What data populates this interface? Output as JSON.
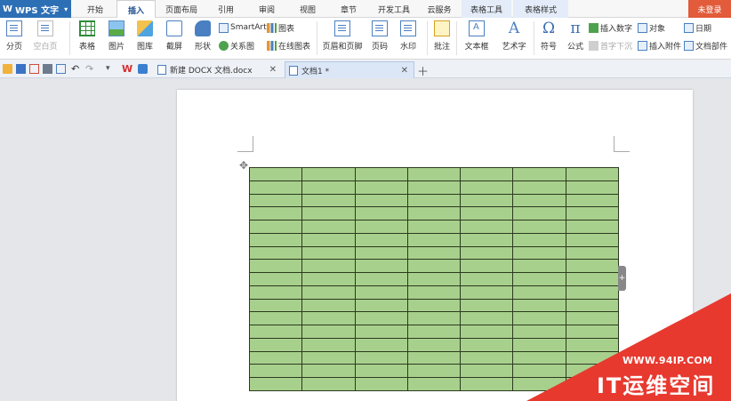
{
  "app": {
    "name": "WPS 文字"
  },
  "menu_tabs": [
    "开始",
    "插入",
    "页面布局",
    "引用",
    "审阅",
    "视图",
    "章节",
    "开发工具",
    "云服务",
    "表格工具",
    "表格样式"
  ],
  "active_tab": "插入",
  "login_label": "未登录",
  "ribbon": {
    "page_break": "分页",
    "blank_page": "空白页",
    "table": "表格",
    "picture": "图片",
    "gallery": "图库",
    "screenshot": "截屏",
    "shapes": "形状",
    "smartart": "SmartArt",
    "chart": "图表",
    "relation_chart": "关系图",
    "online_chart": "在线图表",
    "header_footer": "页眉和页脚",
    "page_number": "页码",
    "watermark": "水印",
    "comment": "批注",
    "textbox": "文本框",
    "wordart": "艺术字",
    "symbol": "符号",
    "formula": "公式",
    "drop_cap": "首字下沉",
    "insert_number": "插入数字",
    "object": "对象",
    "date": "日期",
    "insert_attachment": "插入附件",
    "doc_parts": "文档部件"
  },
  "doc_tabs": [
    {
      "title": "新建 DOCX 文档.docx",
      "active": false
    },
    {
      "title": "文档1 *",
      "active": true
    }
  ],
  "table": {
    "rows": 17,
    "cols": 7,
    "fill_color": "#a8d08d"
  },
  "watermark": {
    "url": "WWW.94IP.COM",
    "brand": "IT运维空间",
    "color": "#e8392f"
  }
}
